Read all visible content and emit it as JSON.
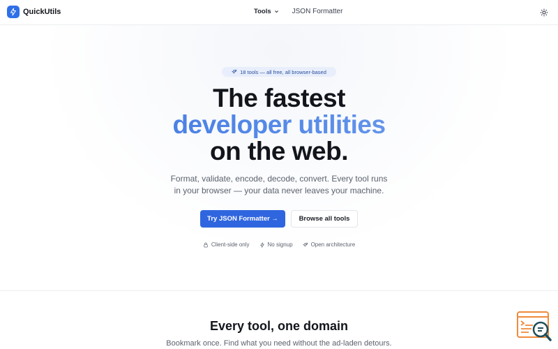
{
  "header": {
    "brand_name": "QuickUtils",
    "nav_tools": "Tools",
    "nav_json": "JSON Formatter",
    "theme_icon": "sun-icon"
  },
  "hero": {
    "pill": "18 tools — all free, all browser-based",
    "headline_1": "The fastest",
    "headline_2": "developer utilities",
    "headline_3": "on the web.",
    "subtitle_1": "Format, validate, encode, decode, convert. Every tool runs",
    "subtitle_2": "in your browser — your data never leaves your machine.",
    "primary_cta": "Try JSON Formatter →",
    "secondary_cta": "Browse all tools",
    "features": [
      "Client-side only",
      "No signup",
      "Open architecture"
    ]
  },
  "section": {
    "title": "Every tool, one domain",
    "subtitle": "Bookmark once. Find what you need without the ad-laden detours."
  },
  "colors": {
    "accent": "#2f66df",
    "gradient_start": "#3a73e2",
    "gradient_end": "#83aaf0",
    "widget_orange": "#f08a3c",
    "widget_teal": "#1f4e5a"
  }
}
